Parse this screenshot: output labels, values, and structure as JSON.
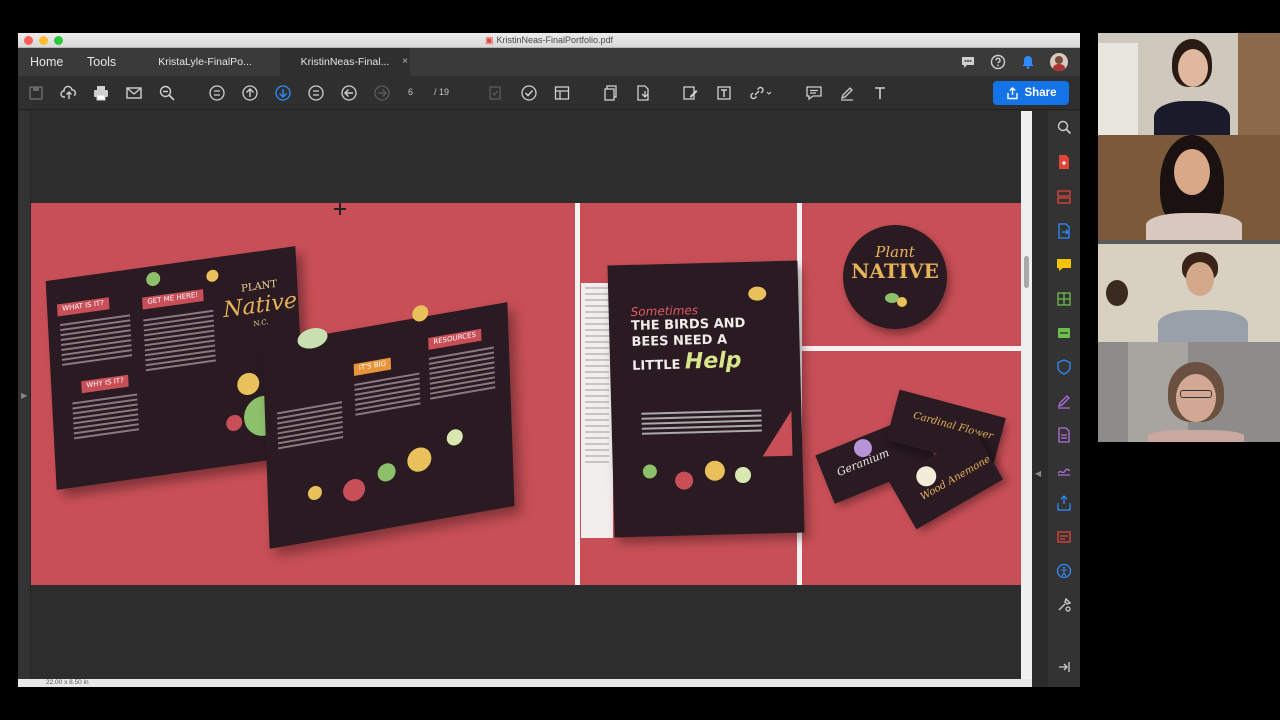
{
  "window": {
    "title": "KristinNeas-FinalPortfolio.pdf"
  },
  "nav": {
    "home": "Home",
    "tools": "Tools"
  },
  "tabs": [
    {
      "label": "KristaLyle-FinalPo..."
    },
    {
      "label": "KristinNeas-Final...",
      "close": "×"
    }
  ],
  "toolbar": {
    "page_current": "6",
    "page_total": "/ 19",
    "share_label": "Share"
  },
  "status": {
    "page_size": "22.00 x 8.50 in"
  },
  "document_art": {
    "brochure_logo_small": "PLANT",
    "brochure_logo_big": "Native",
    "brochure_logo_suffix": "N.C.",
    "brochure_flags": [
      "WHAT IS IT?",
      "GET ME HERE!",
      "WHY IS IT?",
      "IT'S BIG",
      "RESOURCES"
    ],
    "headline_line1": "Sometimes",
    "headline_line2": "THE BIRDS AND BEES NEED A LITTLE",
    "headline_help": "Help",
    "badge_line1": "Plant",
    "badge_line2": "NATIVE",
    "packets": [
      "Geranium",
      "Cardinal Flower",
      "Wood Anemone"
    ]
  },
  "colors": {
    "accent": "#1473e6",
    "page_background": "#c84f57",
    "panel_dark": "#2a1a22",
    "gold": "#e7b35a"
  }
}
